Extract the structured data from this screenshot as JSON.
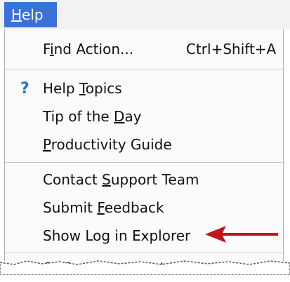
{
  "menubar": {
    "help_tab": {
      "mnemonic": "H",
      "rest": "elp"
    }
  },
  "menu": {
    "items": [
      {
        "pre": "F",
        "mn": "i",
        "post": "nd Action...",
        "shortcut": "Ctrl+Shift+A"
      },
      {
        "pre": "Help ",
        "mn": "T",
        "post": "opics",
        "icon": "help-question-icon"
      },
      {
        "pre": "Tip of the ",
        "mn": "D",
        "post": "ay"
      },
      {
        "pre": "",
        "mn": "P",
        "post": "roductivity Guide"
      },
      {
        "pre": "Contact ",
        "mn": "S",
        "post": "upport Team"
      },
      {
        "pre": "Submit ",
        "mn": "F",
        "post": "eedback"
      },
      {
        "pre": "Show Log in Explorer",
        "mn": "",
        "post": ""
      },
      {
        "pre": "",
        "mn": "O",
        "post": "nline Documentation"
      }
    ]
  },
  "annotation": {
    "arrow_color": "#c0161d"
  },
  "colors": {
    "accent": "#3a72d8",
    "help_icon": "#2a6fd0"
  }
}
